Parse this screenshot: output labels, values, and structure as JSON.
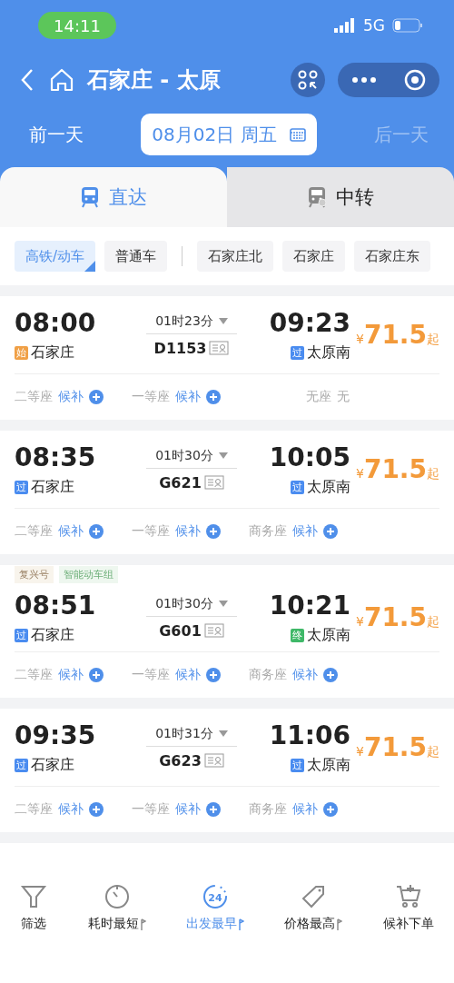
{
  "status_bar": {
    "time": "14:11",
    "network": "5G"
  },
  "nav": {
    "title": "石家庄 - 太原"
  },
  "date_bar": {
    "prev": "前一天",
    "date": "08月02日 周五",
    "next": "后一天",
    "next_disabled": true
  },
  "tabs": [
    {
      "label": "直达",
      "selected": true
    },
    {
      "label": "中转",
      "selected": false
    }
  ],
  "filters": {
    "train_types": [
      {
        "label": "高铁/动车",
        "selected": true
      },
      {
        "label": "普通车",
        "selected": false
      }
    ],
    "stations": [
      {
        "label": "石家庄北",
        "selected": false
      },
      {
        "label": "石家庄",
        "selected": false
      },
      {
        "label": "石家庄东",
        "selected": false
      }
    ]
  },
  "trains": [
    {
      "depart": "08:00",
      "from_badge": {
        "label": "始",
        "color": "#f0a046"
      },
      "from": "石家庄",
      "duration": "01时23分",
      "number": "D1153",
      "arrive": "09:23",
      "to_badge": {
        "label": "过",
        "color": "#4a8cf0"
      },
      "to": "太原南",
      "currency": "¥",
      "price": "71.5",
      "price_suffix": "起",
      "seats": [
        {
          "name": "二等座",
          "status": "候补",
          "plus": true
        },
        {
          "name": "一等座",
          "status": "候补",
          "plus": true
        },
        {
          "name": "无座",
          "status": "无",
          "plus": false
        }
      ]
    },
    {
      "depart": "08:35",
      "from_badge": {
        "label": "过",
        "color": "#4a8cf0"
      },
      "from": "石家庄",
      "duration": "01时30分",
      "number": "G621",
      "arrive": "10:05",
      "to_badge": {
        "label": "过",
        "color": "#4a8cf0"
      },
      "to": "太原南",
      "currency": "¥",
      "price": "71.5",
      "price_suffix": "起",
      "seats": [
        {
          "name": "二等座",
          "status": "候补",
          "plus": true
        },
        {
          "name": "一等座",
          "status": "候补",
          "plus": true
        },
        {
          "name": "商务座",
          "status": "候补",
          "plus": true
        }
      ]
    },
    {
      "tags": [
        {
          "label": "复兴号",
          "kind": "brand"
        },
        {
          "label": "智能动车组",
          "kind": "feature"
        }
      ],
      "depart": "08:51",
      "from_badge": {
        "label": "过",
        "color": "#4a8cf0"
      },
      "from": "石家庄",
      "duration": "01时30分",
      "number": "G601",
      "arrive": "10:21",
      "to_badge": {
        "label": "终",
        "color": "#3fb868"
      },
      "to": "太原南",
      "currency": "¥",
      "price": "71.5",
      "price_suffix": "起",
      "seats": [
        {
          "name": "二等座",
          "status": "候补",
          "plus": true
        },
        {
          "name": "一等座",
          "status": "候补",
          "plus": true
        },
        {
          "name": "商务座",
          "status": "候补",
          "plus": true
        }
      ]
    },
    {
      "depart": "09:35",
      "from_badge": {
        "label": "过",
        "color": "#4a8cf0"
      },
      "from": "石家庄",
      "duration": "01时31分",
      "number": "G623",
      "arrive": "11:06",
      "to_badge": {
        "label": "过",
        "color": "#4a8cf0"
      },
      "to": "太原南",
      "currency": "¥",
      "price": "71.5",
      "price_suffix": "起",
      "seats": [
        {
          "name": "二等座",
          "status": "候补",
          "plus": true
        },
        {
          "name": "一等座",
          "status": "候补",
          "plus": true
        },
        {
          "name": "商务座",
          "status": "候补",
          "plus": true
        }
      ]
    }
  ],
  "bottom_bar": [
    {
      "kind": "filter",
      "label": "筛选",
      "selected": false,
      "sortable": false
    },
    {
      "kind": "timer",
      "label": "耗时最短",
      "selected": false,
      "sortable": true
    },
    {
      "kind": "clock24",
      "label": "出发最早",
      "icon_text": "24",
      "selected": true,
      "sortable": true
    },
    {
      "kind": "tag",
      "label": "价格最高",
      "selected": false,
      "sortable": true
    },
    {
      "kind": "cart",
      "label": "候补下单",
      "selected": false,
      "sortable": false
    }
  ]
}
